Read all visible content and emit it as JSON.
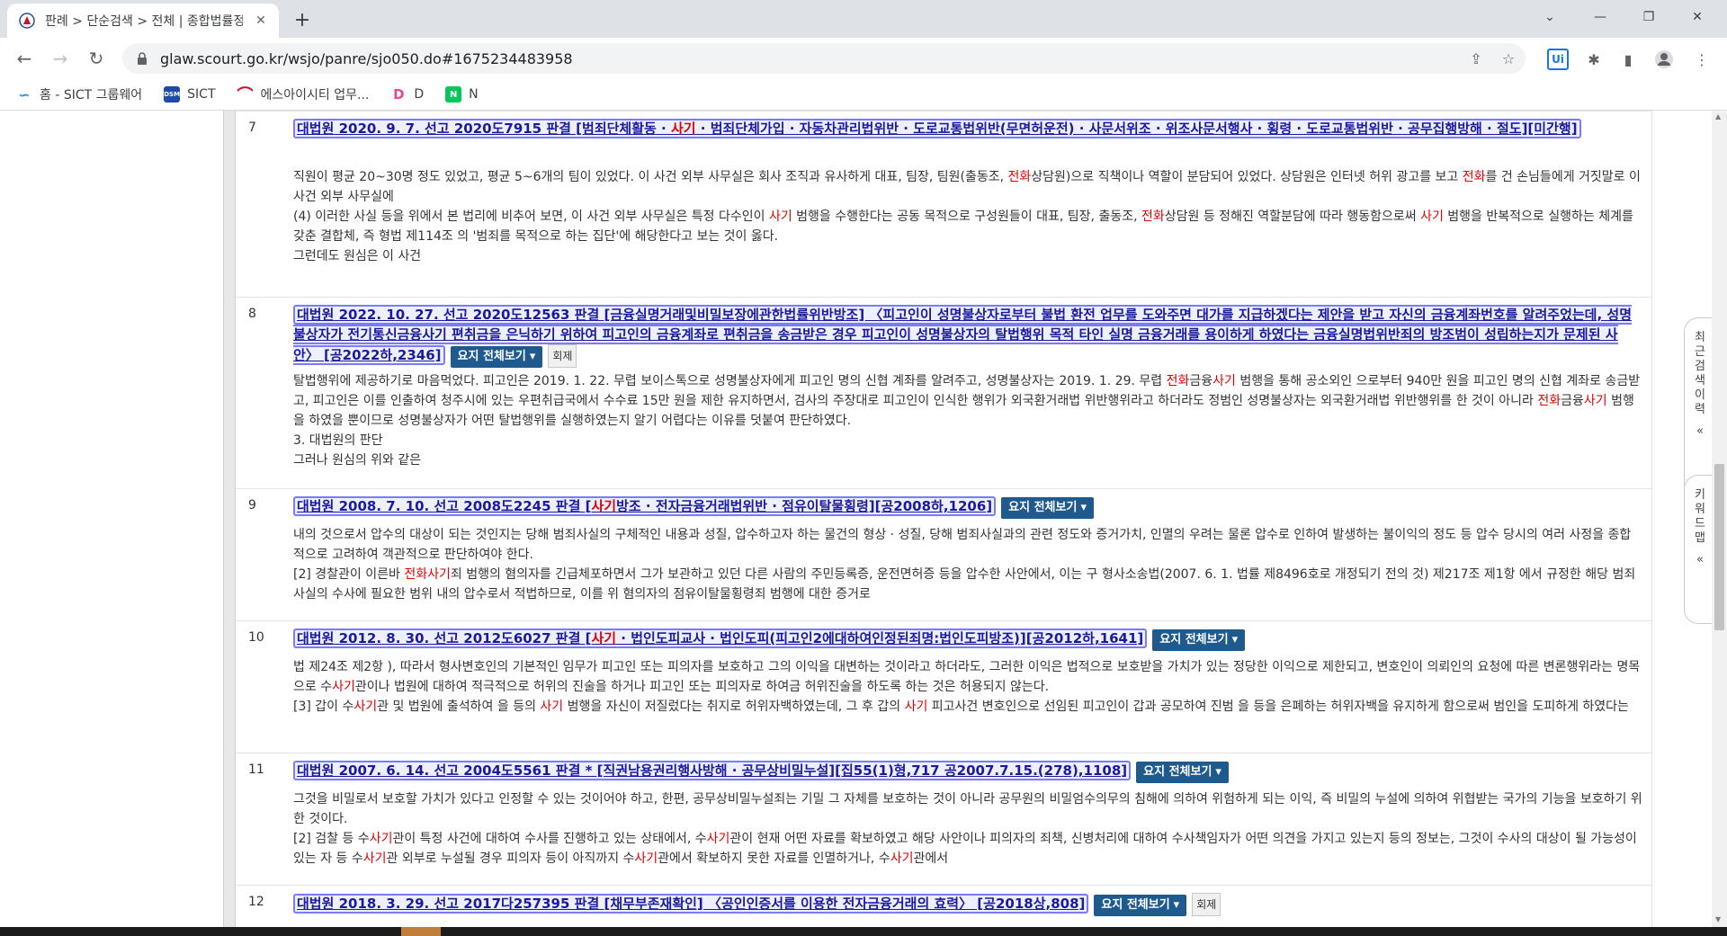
{
  "tab": {
    "title": "판례 > 단순검색 > 전체 | 종합법률정보"
  },
  "address": {
    "url": "glaw.scourt.go.kr/wsjo/panre/sjo050.do#1675234483958"
  },
  "bookmarks": [
    {
      "label": "홈 - SICT 그룹웨어",
      "icon": "sict-groupware-icon",
      "color": "#2f8fd8",
      "glyph": "∽"
    },
    {
      "label": "SICT",
      "icon": "dsm-icon",
      "color": "#1f4aa8",
      "glyph": "DSM"
    },
    {
      "label": "에스아이시티 업무...",
      "icon": "sict-arc-icon",
      "color": "#c8102e",
      "glyph": "⌒"
    },
    {
      "label": "D",
      "icon": "d-icon",
      "color": "#e44b8d",
      "glyph": "D"
    },
    {
      "label": "N",
      "icon": "naver-icon",
      "color": "#03c75a",
      "glyph": "N"
    }
  ],
  "results": [
    {
      "num": "7",
      "title": [
        {
          "t": "대법원 2020. 9. 7. 선고 2020도7915 판결 [범죄단체활동 · "
        },
        {
          "t": "사기",
          "h": true
        },
        {
          "t": " · 범죄단체가입 · 자동차관리법위반 · 도로교통법위반(무면허운전) · 사문서위조 · 위조사문서행사 · 횡령 · 도로교통법위반 · 공무집행방해 · 절도][미간행]"
        }
      ],
      "badge": "",
      "badge2": "",
      "lines": [
        [
          {
            "t": "직원이 평균 20~30명 정도 있었고, 평균 5~6개의 팀이 있었다. 이 사건 외부 사무실은 회사 조직과 유사하게 대표, 팀장, 팀원(출동조, "
          },
          {
            "t": "전화",
            "h": true
          },
          {
            "t": "상담원)으로 직책이나 역할이 분담되어 있었다. 상담원은 인터넷 허위 광고를 보고 "
          },
          {
            "t": "전화",
            "h": true
          },
          {
            "t": "를 건 손님들에게 거짓말로 이 사건 외부 사무실에"
          }
        ],
        [
          {
            "t": "(4) 이러한 사실 등을 위에서 본 법리에 비추어 보면, 이 사건 외부 사무실은 특정 다수인이 "
          },
          {
            "t": "사기",
            "h": true
          },
          {
            "t": " 범행을 수행한다는 공동 목적으로 구성원들이 대표, 팀장, 출동조, "
          },
          {
            "t": "전화",
            "h": true
          },
          {
            "t": "상담원 등 정해진 역할분담에 따라 행동함으로써 "
          },
          {
            "t": "사기",
            "h": true
          },
          {
            "t": " 범행을 반복적으로 실행하는 체계를 갖춘 결합체, 즉 형법 제114조 의 '범죄를 목적으로 하는 집단'에 해당한다고 보는 것이 옳다."
          }
        ],
        [
          {
            "t": "그런데도 원심은 이 사건"
          }
        ]
      ]
    },
    {
      "num": "8",
      "title": [
        {
          "t": "대법원 2022. 10. 27. 선고 2020도12563 판결 [금융실명거래및비밀보장에관한법률위반방조] 〈피고인이 성명불상자로부터 불법 환전 업무를 도와주면 대가를 지급하겠다는 제안을 받고 자신의 금융계좌번호를 알려주었는데, 성명불상자가 전기통신금융사기 편취금을 은닉하기 위하여 피고인의 금융계좌로 편취금을 송금받은 경우 피고인이 성명불상자의 탈법행위 목적 타인 실명 금융거래를 용이하게 하였다는 금융실명법위반죄의 방조범이 성립하는지가 문제된 사안〉 [공2022하,2346]"
        }
      ],
      "badge": "요지 전체보기",
      "badge2": "회제",
      "lines": [
        [
          {
            "t": "탈법행위에 제공하기로 마음먹었다. 피고인은 2019. 1. 22. 무렵 보이스톡으로 성명불상자에게 피고인 명의 신협 계좌를 알려주고, 성명불상자는 2019. 1. 29. 무렵 "
          },
          {
            "t": "전화",
            "h": true
          },
          {
            "t": "금융"
          },
          {
            "t": "사기",
            "h": true
          },
          {
            "t": " 범행을 통해 공소외인 으로부터 940만 원을 피고인 명의 신협 계좌로 송금받고, 피고인은 이를 인출하여 청주시에 있는 우편취급국에서 수수료 15만 원을 제한 유지하면서, 검사의 주장대로 피고인이 인식한 행위가 외국환거래법 위반행위라고 하더라도 정범인 성명불상자는 외국환거래법 위반행위를 한 것이 아니라 "
          },
          {
            "t": "전화",
            "h": true
          },
          {
            "t": "금융"
          },
          {
            "t": "사기",
            "h": true
          },
          {
            "t": " 범행을 하였을 뿐이므로 성명불상자가 어떤 탈법행위를 실행하였는지 알기 어렵다는 이유를 덧붙여 판단하였다."
          }
        ],
        [
          {
            "t": "3. 대법원의 판단"
          }
        ],
        [
          {
            "t": "그러나 원심의 위와 같은"
          }
        ]
      ]
    },
    {
      "num": "9",
      "title": [
        {
          "t": "대법원 2008. 7. 10. 선고 2008도2245 판결 ["
        },
        {
          "t": "사기",
          "h": true
        },
        {
          "t": "방조 · 전자금융거래법위반 · 점유이탈물횡령][공2008하,1206]"
        }
      ],
      "badge": "요지 전체보기",
      "badge2": "",
      "lines": [
        [
          {
            "t": "내의 것으로서 압수의 대상이 되는 것인지는 당해 범죄사실의 구체적인 내용과 성질, 압수하고자 하는 물건의 형상 · 성질, 당해 범죄사실과의 관련 정도와 증거가치, 인멸의 우려는 물론 압수로 인하여 발생하는 불이익의 정도 등 압수 당시의 여러 사정을 종합적으로 고려하여 객관적으로 판단하여야 한다."
          }
        ],
        [
          {
            "t": "[2] 경찰관이 이른바 "
          },
          {
            "t": "전화사기",
            "h": true
          },
          {
            "t": "죄 범행의 혐의자를 긴급체포하면서 그가 보관하고 있던 다른 사람의 주민등록증, 운전면허증 등을 압수한 사안에서, 이는 구 형사소송법(2007. 6. 1. 법률 제8496호로 개정되기 전의 것) 제217조 제1항 에서 규정한 해당 범죄사실의 수사에 필요한 범위 내의 압수로서 적법하므로, 이를 위 혐의자의 점유이탈물횡령죄 범행에 대한 증거로"
          }
        ]
      ]
    },
    {
      "num": "10",
      "title": [
        {
          "t": "대법원 2012. 8. 30. 선고 2012도6027 판결 ["
        },
        {
          "t": "사기",
          "h": true
        },
        {
          "t": " · 법인도피교사 · 법인도피(피고인2에대하여인정된죄명:법인도피방조)][공2012하,1641]"
        }
      ],
      "badge": "요지 전체보기",
      "badge2": "",
      "lines": [
        [
          {
            "t": "법 제24조 제2항 ), 따라서 형사변호인의 기본적인 임무가 피고인 또는 피의자를 보호하고 그의 이익을 대변하는 것이라고 하더라도, 그러한 이익은 법적으로 보호받을 가치가 있는 정당한 이익으로 제한되고, 변호인이 의뢰인의 요청에 따른 변론행위라는 명목으로 수"
          },
          {
            "t": "사기",
            "h": true
          },
          {
            "t": "관이나 법원에 대하여 적극적으로 허위의 진술을 하거나 피고인 또는 피의자로 하여금 허위진술을 하도록 하는 것은 허용되지 않는다."
          }
        ],
        [
          {
            "t": "[3] 갑이 수"
          },
          {
            "t": "사기",
            "h": true
          },
          {
            "t": "관 및 법원에 출석하여 을 등의 "
          },
          {
            "t": "사기",
            "h": true
          },
          {
            "t": " 범행을 자신이 저질렀다는 취지로 허위자백하였는데, 그 후 갑의 "
          },
          {
            "t": "사기",
            "h": true
          },
          {
            "t": " 피고사건 변호인으로 선임된 피고인이 갑과 공모하여 진범 을 등을 은폐하는 허위자백을 유지하게 함으로써 범인을 도피하게 하였다는"
          }
        ]
      ]
    },
    {
      "num": "11",
      "title": [
        {
          "t": "대법원 2007. 6. 14. 선고 2004도5561 판결 * [직권남용권리행사방해 · 공무상비밀누설][집55(1)형,717 공2007.7.15.(278),1108]"
        }
      ],
      "badge": "요지 전체보기",
      "badge2": "",
      "lines": [
        [
          {
            "t": "그것을 비밀로서 보호할 가치가 있다고 인정할 수 있는 것이어야 하고, 한편, 공무상비밀누설죄는 기밀 그 자체를 보호하는 것이 아니라 공무원의 비밀엄수의무의 침해에 의하여 위험하게 되는 이익, 즉 비밀의 누설에 의하여 위협받는 국가의 기능을 보호하기 위한 것이다."
          }
        ],
        [
          {
            "t": "[2] 검찰 등 수"
          },
          {
            "t": "사기",
            "h": true
          },
          {
            "t": "관이 특정 사건에 대하여 수사를 진행하고 있는 상태에서, 수"
          },
          {
            "t": "사기",
            "h": true
          },
          {
            "t": "관이 현재 어떤 자료를 확보하였고 해당 사안이나 피의자의 죄책, 신병처리에 대하여 수사책임자가 어떤 의견을 가지고 있는지 등의 정보는, 그것이 수사의 대상이 될 가능성이 있는 자 등 수"
          },
          {
            "t": "사기",
            "h": true
          },
          {
            "t": "관 외부로 누설될 경우 피의자 등이 아직까지 수"
          },
          {
            "t": "사기",
            "h": true
          },
          {
            "t": "관에서 확보하지 못한 자료를 인멸하거나, 수"
          },
          {
            "t": "사기",
            "h": true
          },
          {
            "t": "관에서"
          }
        ]
      ]
    },
    {
      "num": "12",
      "title": [
        {
          "t": "대법원 2018. 3. 29. 선고 2017다257395 판결 [채무부존재확인] 〈공인인증서를 이용한 전자금융거래의 효력〉 [공2018상,808]"
        }
      ],
      "badge": "요지 전체보기",
      "badge2": "회제",
      "lines": []
    }
  ],
  "side_tabs": [
    {
      "label": "최근검색이력",
      "arrow": "«"
    },
    {
      "label": "키워드맵",
      "arrow": "«"
    }
  ]
}
